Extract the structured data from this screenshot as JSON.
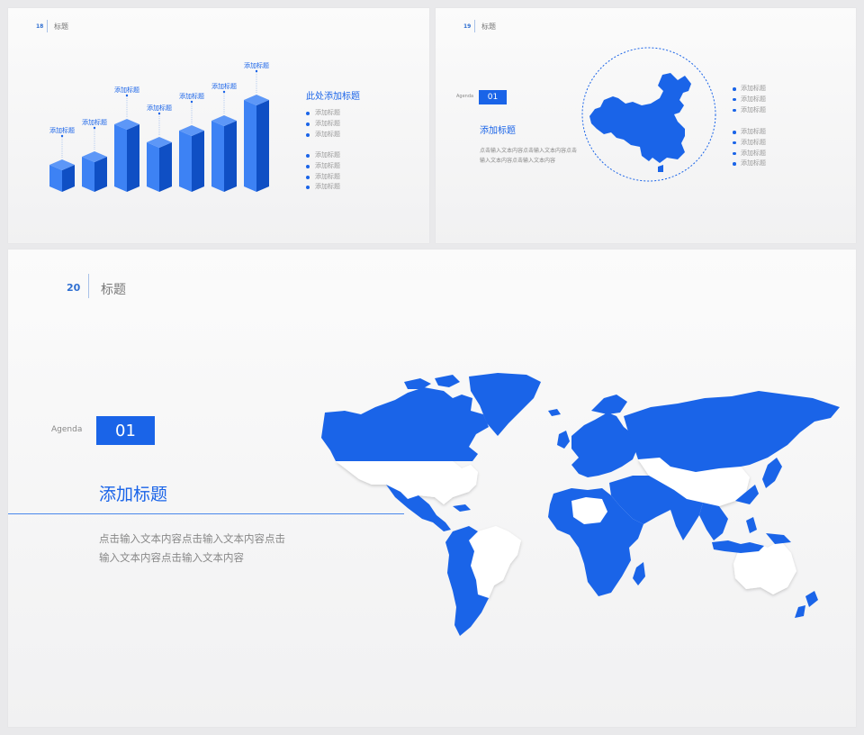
{
  "colors": {
    "accent": "#1a64e8",
    "accent_light": "#3d82f4",
    "accent_dark": "#0f4fc4",
    "slide_bg": "#f6f6f7"
  },
  "slide18": {
    "page_number": "18",
    "header_title": "标题",
    "chart_data": {
      "type": "bar",
      "categories": [
        "添加标题",
        "添加标题",
        "添加标题",
        "添加标题",
        "添加标题",
        "添加标题",
        "添加标题"
      ],
      "values": [
        30,
        39,
        75,
        55,
        68,
        79,
        102
      ],
      "series": [
        {
          "values": [
            30,
            39,
            75,
            55,
            68,
            79,
            102
          ]
        }
      ]
    },
    "right_title": "此处添加标题",
    "list_group1": [
      "添加标题",
      "添加标题",
      "添加标题"
    ],
    "list_group2": [
      "添加标题",
      "添加标题",
      "添加标题",
      "添加标题"
    ]
  },
  "slide19": {
    "page_number": "19",
    "header_title": "标题",
    "agenda_label": "Agenda",
    "number": "01",
    "subtitle": "添加标题",
    "body_lines": [
      "点击输入文本内容点击输入文本内容点击",
      "输入文本内容点击输入文本内容"
    ],
    "map_icon": "china-map-icon",
    "list_group1": [
      "添加标题",
      "添加标题",
      "添加标题"
    ],
    "list_group2": [
      "添加标题",
      "添加标题",
      "添加标题",
      "添加标题"
    ]
  },
  "slide20": {
    "page_number": "20",
    "header_title": "标题",
    "agenda_label": "Agenda",
    "number": "01",
    "subtitle": "添加标题",
    "body_lines": [
      "点击输入文本内容点击输入文本内容点击",
      "输入文本内容点击输入文本内容"
    ],
    "map_icon": "world-map-icon"
  }
}
